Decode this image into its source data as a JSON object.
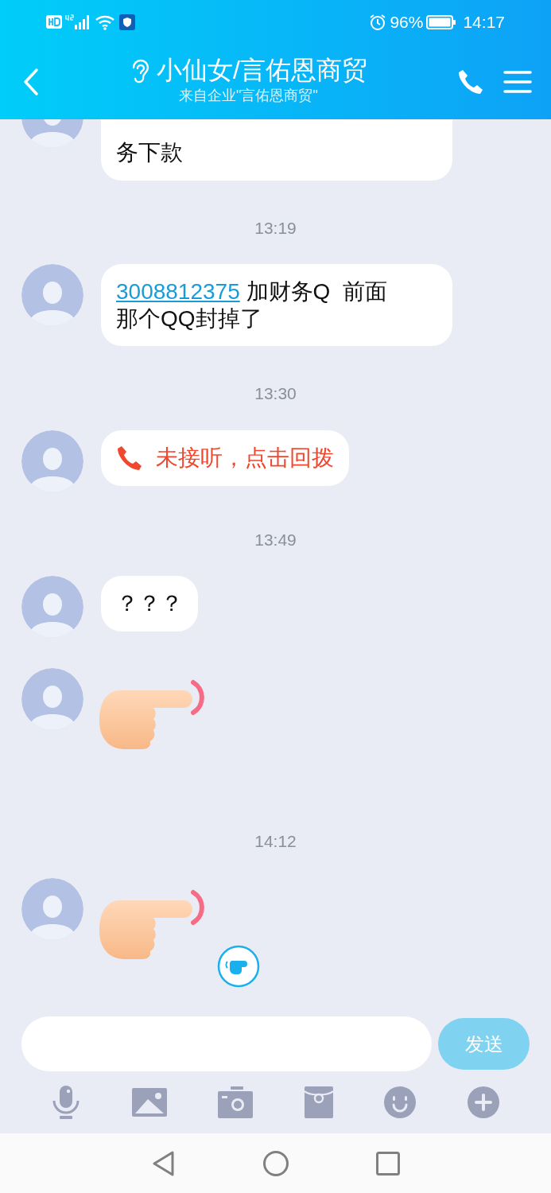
{
  "status_bar": {
    "battery": "96%",
    "time": "14:17"
  },
  "header": {
    "title": "小仙女/言佑恩商贸",
    "subtitle": "来自企业\"言佑恩商贸\""
  },
  "messages": [
    {
      "kind": "text",
      "cut_top": true,
      "text": "务下款"
    },
    {
      "kind": "time",
      "text": "13:19"
    },
    {
      "kind": "text",
      "link": "3008812375",
      "text": " 加财务Q  前面那个QQ封掉了"
    },
    {
      "kind": "time",
      "text": "13:30"
    },
    {
      "kind": "missed_call",
      "text": "未接听，点击回拨"
    },
    {
      "kind": "time",
      "text": "13:49"
    },
    {
      "kind": "text",
      "text": "？？？"
    },
    {
      "kind": "sticker"
    },
    {
      "kind": "time",
      "text": "14:12"
    },
    {
      "kind": "sticker",
      "badge": true
    }
  ],
  "composer": {
    "send": "发送",
    "send_disabled": true
  }
}
